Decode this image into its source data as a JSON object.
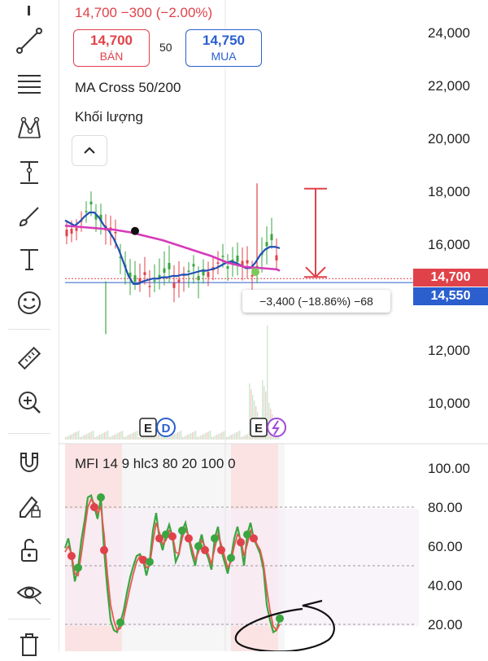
{
  "header": {
    "price_change": "14,700 −300 (−2.00%)",
    "sell_price": "14,700",
    "sell_label": "BÁN",
    "quantity": "50",
    "buy_price": "14,750",
    "buy_label": "MUA"
  },
  "indicators": {
    "ma_cross": "MA Cross 50/200",
    "volume": "Khối lượng",
    "mfi": "MFI 14 9 hlc3 80 20 100 0"
  },
  "price_axis": {
    "ticks": [
      "24,000",
      "22,000",
      "20,000",
      "18,000",
      "16,000",
      "12,000",
      "10,000"
    ],
    "last_price_tag": "14,700",
    "blue_price_tag": "14,550"
  },
  "measure_tooltip": "−3,400 (−18.86%) −68",
  "mfi_axis": {
    "ticks": [
      "100.00",
      "80.00",
      "60.00",
      "40.00",
      "20.00"
    ]
  },
  "event_markers": [
    "E",
    "D",
    "E"
  ],
  "colors": {
    "sell": "#e0424a",
    "buy": "#2b5fce",
    "ma_fast": "#1f4fb5",
    "ma_slow": "#d63ab8",
    "mfi_line": "#3aa640",
    "mfi_signal": "#e8584f"
  },
  "toolbar": {
    "icons": [
      "cursor-icon",
      "trend-line-icon",
      "fib-retracement-icon",
      "pattern-icon",
      "projection-icon",
      "brush-icon",
      "text-icon",
      "emoji-icon",
      "ruler-icon",
      "zoom-in-icon",
      "magnet-icon",
      "lock-drawing-icon",
      "unlock-icon",
      "eye-icon",
      "trash-icon"
    ]
  },
  "chart_data": [
    {
      "type": "line",
      "title": "",
      "ylim": [
        9000,
        24800
      ],
      "y_ticks": [
        24000,
        22000,
        20000,
        18000,
        16000,
        12000,
        10000
      ],
      "series": [
        {
          "name": "",
          "color": "#1f4fb5",
          "x": [
            0,
            6,
            12,
            18,
            24,
            30,
            36,
            42,
            48,
            54,
            60,
            66,
            72,
            78,
            84,
            90,
            96,
            102,
            108,
            114,
            120,
            126,
            132,
            138,
            144,
            150,
            156,
            162,
            168,
            174,
            180,
            186,
            192,
            198,
            204,
            210,
            216,
            222,
            228,
            234,
            240,
            246,
            252,
            258,
            264
          ],
          "values": [
            16900,
            16800,
            16700,
            16850,
            17050,
            17200,
            17200,
            17000,
            16700,
            16500,
            16200,
            15800,
            15300,
            14800,
            14500,
            14500,
            14600,
            14650,
            14700,
            14700,
            14750,
            14750,
            14800,
            14800,
            14850,
            14850,
            14900,
            14950,
            15000,
            15000,
            15050,
            15100,
            15200,
            15300,
            15350,
            15300,
            15200,
            15100,
            15100,
            15300,
            15600,
            15800,
            15900,
            15900,
            15850
          ]
        },
        {
          "name": "",
          "color": "#d63ab8",
          "x": [
            0,
            20,
            40,
            60,
            80,
            100,
            120,
            140,
            160,
            180,
            200,
            220,
            240,
            260,
            264
          ],
          "values": [
            16700,
            16650,
            16600,
            16550,
            16450,
            16300,
            16150,
            15950,
            15750,
            15550,
            15300,
            15150,
            15100,
            15050,
            15000
          ]
        }
      ],
      "crosses": [
        {
          "x": 86,
          "y": 16500,
          "color": "#111111"
        },
        {
          "x": 234,
          "y": 14950,
          "color": "#7cc95a"
        }
      ],
      "measure": {
        "from": 18100,
        "to": 14700
      }
    },
    {
      "type": "line",
      "title": "",
      "ylim": [
        14,
        100
      ],
      "y_ticks": [
        100,
        80,
        60,
        40,
        20
      ],
      "series": [
        {
          "name": "",
          "color": "#3aa640",
          "x": [
            0,
            4,
            8,
            12,
            16,
            20,
            24,
            28,
            32,
            36,
            40,
            44,
            48,
            52,
            56,
            60,
            64,
            68,
            72,
            76,
            80,
            84,
            88,
            92,
            96,
            100,
            104,
            108,
            112,
            116,
            120,
            124,
            128,
            132,
            136,
            140,
            144,
            148,
            152,
            156,
            160,
            164,
            168,
            172,
            176,
            180,
            184,
            188,
            192,
            196,
            200,
            204,
            208,
            212,
            216,
            220,
            224,
            228,
            232,
            236,
            240,
            244,
            248,
            252,
            256,
            260,
            264
          ],
          "values": [
            59,
            64,
            55,
            42,
            49,
            63,
            73,
            85,
            86,
            80,
            74,
            85,
            58,
            38,
            22,
            17,
            16,
            21,
            27,
            36,
            44,
            50,
            55,
            56,
            53,
            45,
            52,
            68,
            77,
            64,
            58,
            66,
            71,
            65,
            52,
            56,
            68,
            72,
            64,
            56,
            50,
            60,
            66,
            58,
            54,
            48,
            64,
            70,
            58,
            52,
            46,
            54,
            64,
            70,
            62,
            50,
            66,
            72,
            64,
            60,
            56,
            48,
            30,
            22,
            16,
            17,
            23
          ]
        },
        {
          "name": "",
          "color": "#e8584f",
          "x": [
            0,
            4,
            8,
            12,
            16,
            20,
            24,
            28,
            32,
            36,
            40,
            44,
            48,
            52,
            56,
            60,
            64,
            68,
            72,
            76,
            80,
            84,
            88,
            92,
            96,
            100,
            104,
            108,
            112,
            116,
            120,
            124,
            128,
            132,
            136,
            140,
            144,
            148,
            152,
            156,
            160,
            164,
            168,
            172,
            176,
            180,
            184,
            188,
            192,
            196,
            200,
            204,
            208,
            212,
            216,
            220,
            224,
            228,
            232,
            236,
            240,
            244,
            248,
            252,
            256,
            260,
            264
          ],
          "values": [
            57,
            60,
            56,
            46,
            45,
            56,
            68,
            80,
            84,
            82,
            77,
            80,
            66,
            46,
            30,
            22,
            17,
            18,
            23,
            31,
            39,
            46,
            52,
            55,
            54,
            49,
            50,
            62,
            72,
            67,
            61,
            63,
            68,
            66,
            57,
            56,
            64,
            69,
            65,
            59,
            53,
            57,
            63,
            60,
            56,
            51,
            59,
            66,
            61,
            55,
            49,
            52,
            60,
            66,
            64,
            55,
            61,
            68,
            65,
            61,
            58,
            51,
            38,
            27,
            19,
            17,
            20
          ]
        }
      ],
      "bands": {
        "upper": 80,
        "lower": 20,
        "middle": 50
      }
    }
  ]
}
